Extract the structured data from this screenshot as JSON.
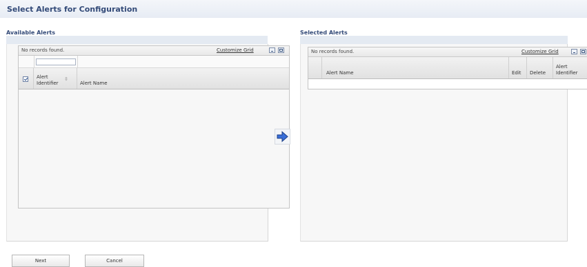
{
  "page_title": "Select Alerts for Configuration",
  "available": {
    "title": "Available Alerts",
    "status": "No records found.",
    "customize": "Customize Grid",
    "columns": {
      "alert_identifier": "Alert Identifier",
      "alert_name": "Alert Name"
    }
  },
  "selected": {
    "title": "Selected Alerts",
    "status": "No records found.",
    "customize": "Customize Grid",
    "columns": {
      "alert_name": "Alert Name",
      "edit": "Edit",
      "delete": "Delete",
      "alert_identifier": "Alert Identifier"
    }
  },
  "buttons": {
    "next": "Next",
    "cancel": "Cancel"
  },
  "colors": {
    "title_text": "#334a78",
    "arrow_fill": "#3a6fd8",
    "band": "#e4eaf2"
  }
}
